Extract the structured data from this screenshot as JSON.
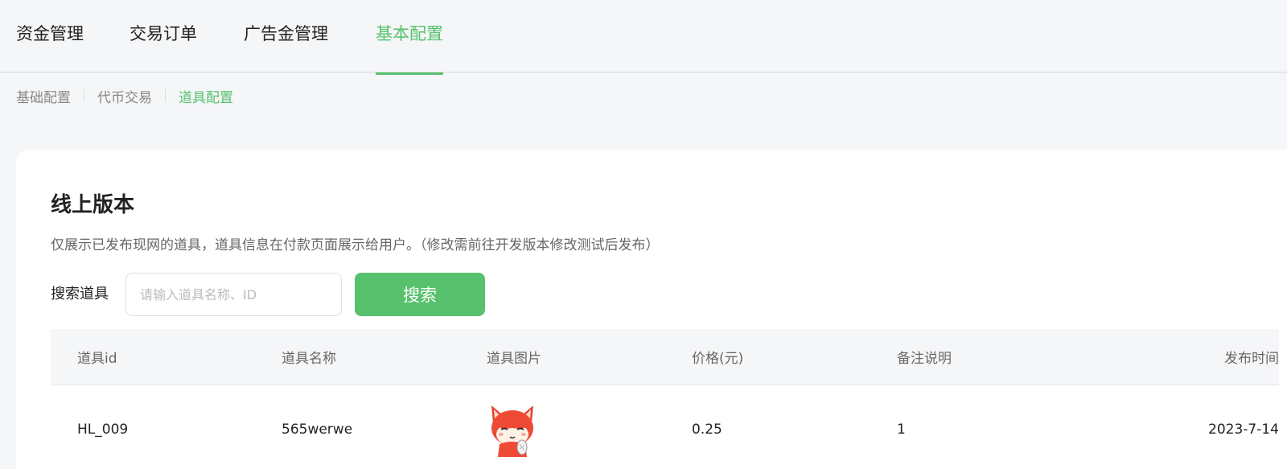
{
  "top_tabs": [
    {
      "label": "资金管理"
    },
    {
      "label": "交易订单"
    },
    {
      "label": "广告金管理"
    },
    {
      "label": "基本配置"
    }
  ],
  "sub_tabs": [
    {
      "label": "基础配置"
    },
    {
      "label": "代币交易"
    },
    {
      "label": "道具配置"
    }
  ],
  "card": {
    "title": "线上版本",
    "description": "仅展示已发布现网的道具，道具信息在付款页面展示给用户。（修改需前往开发版本修改测试后发布）",
    "search_label": "搜索道具",
    "search_placeholder": "请输入道具名称、ID",
    "search_value": "",
    "search_button": "搜索"
  },
  "table": {
    "headers": [
      "道具id",
      "道具名称",
      "道具图片",
      "价格(元)",
      "备注说明",
      "发布时间"
    ],
    "rows": [
      {
        "id": "HL_009",
        "name": "565werwe",
        "image_icon": "fox-mascot-icon",
        "price": "0.25",
        "note": "1",
        "published": "2023-7-14"
      }
    ]
  },
  "colors": {
    "accent": "#57c16d",
    "background": "#f5f6f8",
    "card": "#ffffff"
  }
}
